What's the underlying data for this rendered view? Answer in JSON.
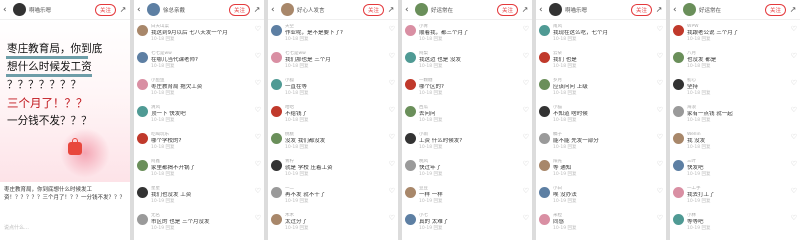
{
  "panels": [
    {
      "username": "啊喵乐嗯",
      "follow_label": "关注",
      "hero_lines": [
        "枣庄教育局，你到底",
        "想什么时候发工资",
        "？？？？？？？",
        "三个月了！？？",
        "一分钱不发？？？"
      ],
      "caption": "枣庄教育局，你到底想什么时候发工资！？？？？？三个月了！？？一分钱不发？？？",
      "caption_footer": "说点什么…"
    },
    {
      "username": "徐总亲戴",
      "follow_label": "关注",
      "comments": [
        {
          "name": "白天山菜",
          "text": "我这到9月以后 七八天发一个月",
          "meta": "10-18 回复"
        },
        {
          "name": "七七是ww",
          "text": "在哪儿当代课老师?",
          "meta": "10-18 回复"
        },
        {
          "name": "小鱼鱼",
          "text": "枣庄教育局 拖欠工资",
          "meta": "10-18 回复"
        },
        {
          "name": "清风",
          "text": "顶一下 快发吧",
          "meta": "10-18 回复"
        },
        {
          "name": "吃喝玩乐",
          "text": "哪个学校的?",
          "meta": "10-18 回复"
        },
        {
          "name": "阿鑫",
          "text": "家里都揭不开锅了",
          "meta": "10-18 回复"
        },
        {
          "name": "星星",
          "text": "我们也没发 工资",
          "meta": "10-19 回复"
        },
        {
          "name": "无名",
          "text": "市区的 也是 三个月没发",
          "meta": "10-19 回复"
        }
      ]
    },
    {
      "username": "好心人发言",
      "follow_label": "关注",
      "comments": [
        {
          "name": "天空",
          "text": "作业呢，是不是要下了?",
          "meta": "10-18 回复"
        },
        {
          "name": "七七是ww",
          "text": "我们那也是 三个月",
          "meta": "10-18 回复"
        },
        {
          "name": "小狐",
          "text": "一直在等",
          "meta": "10-18 回复"
        },
        {
          "name": "哈哈",
          "text": "不给钱了",
          "meta": "10-18 回复"
        },
        {
          "name": "桃桃",
          "text": "没发 我们都没发",
          "meta": "10-18 回复"
        },
        {
          "name": "青柠",
          "text": "就是 学校 压着工资",
          "meta": "10-19 回复"
        },
        {
          "name": "一二",
          "text": "再不发 就不干了",
          "meta": "10-19 回复"
        },
        {
          "name": "木木",
          "text": "太过分了",
          "meta": "10-19 回复"
        }
      ]
    },
    {
      "username": "好运常在",
      "follow_label": "关注",
      "comments": [
        {
          "name": "小青",
          "text": "顺着我，都三个月了",
          "meta": "10-18 回复"
        },
        {
          "name": "阿梨",
          "text": "我这边 也是 没发",
          "meta": "10-18 回复"
        },
        {
          "name": "一颗糖",
          "text": "哪个区的?",
          "meta": "10-18 回复"
        },
        {
          "name": "西瓜",
          "text": "去问问",
          "meta": "10-18 回复"
        },
        {
          "name": "小雨",
          "text": "工资 什么时候发?",
          "meta": "10-18 回复"
        },
        {
          "name": "晚风",
          "text": "快过年了",
          "meta": "10-19 回复"
        },
        {
          "name": "豆豆",
          "text": "一样 一样",
          "meta": "10-19 回复"
        },
        {
          "name": "小七",
          "text": "真的 太难了",
          "meta": "10-19 回复"
        }
      ]
    },
    {
      "username": "啊喵乐嗯",
      "follow_label": "关注",
      "comments": [
        {
          "name": "南风",
          "text": "我现在这么吃，七个月",
          "meta": "10-18 回复"
        },
        {
          "name": "云朵",
          "text": "我们 也是",
          "meta": "10-18 回复"
        },
        {
          "name": "岁月",
          "text": "应该问问 上级",
          "meta": "10-18 回复"
        },
        {
          "name": "小猫",
          "text": "不知道 啥时候",
          "meta": "10-18 回复"
        },
        {
          "name": "橘子",
          "text": "能不能 先发一部分",
          "meta": "10-18 回复"
        },
        {
          "name": "阳光",
          "text": "等 通知",
          "meta": "10-19 回复"
        },
        {
          "name": "小白",
          "text": "唉 没办法",
          "meta": "10-19 回复"
        },
        {
          "name": "米粒",
          "text": "同感",
          "meta": "10-19 回复"
        }
      ]
    },
    {
      "username": "好运常在",
      "follow_label": "关注",
      "comments": [
        {
          "name": "WPW",
          "text": "我跟老公说 三个月了",
          "meta": "10-18 回复"
        },
        {
          "name": "八月",
          "text": "也没发 都是",
          "meta": "10-18 回复"
        },
        {
          "name": "初心",
          "text": "坚持",
          "meta": "10-18 回复"
        },
        {
          "name": "海浪",
          "text": "家有一点钱 就一起",
          "meta": "10-18 回复"
        },
        {
          "name": "Wellin",
          "text": "我 没发",
          "meta": "10-18 回复"
        },
        {
          "name": "三叶",
          "text": "快发吧",
          "meta": "10-19 回复"
        },
        {
          "name": "一工手",
          "text": "我去打工了",
          "meta": "10-19 回复"
        },
        {
          "name": "小林",
          "text": "等等吧",
          "meta": "10-19 回复"
        }
      ]
    }
  ],
  "icons": {
    "back": "‹",
    "share": "↗",
    "like": "♡"
  },
  "colors": {
    "accent": "#e4393c",
    "headline_red": "#c0151b"
  }
}
